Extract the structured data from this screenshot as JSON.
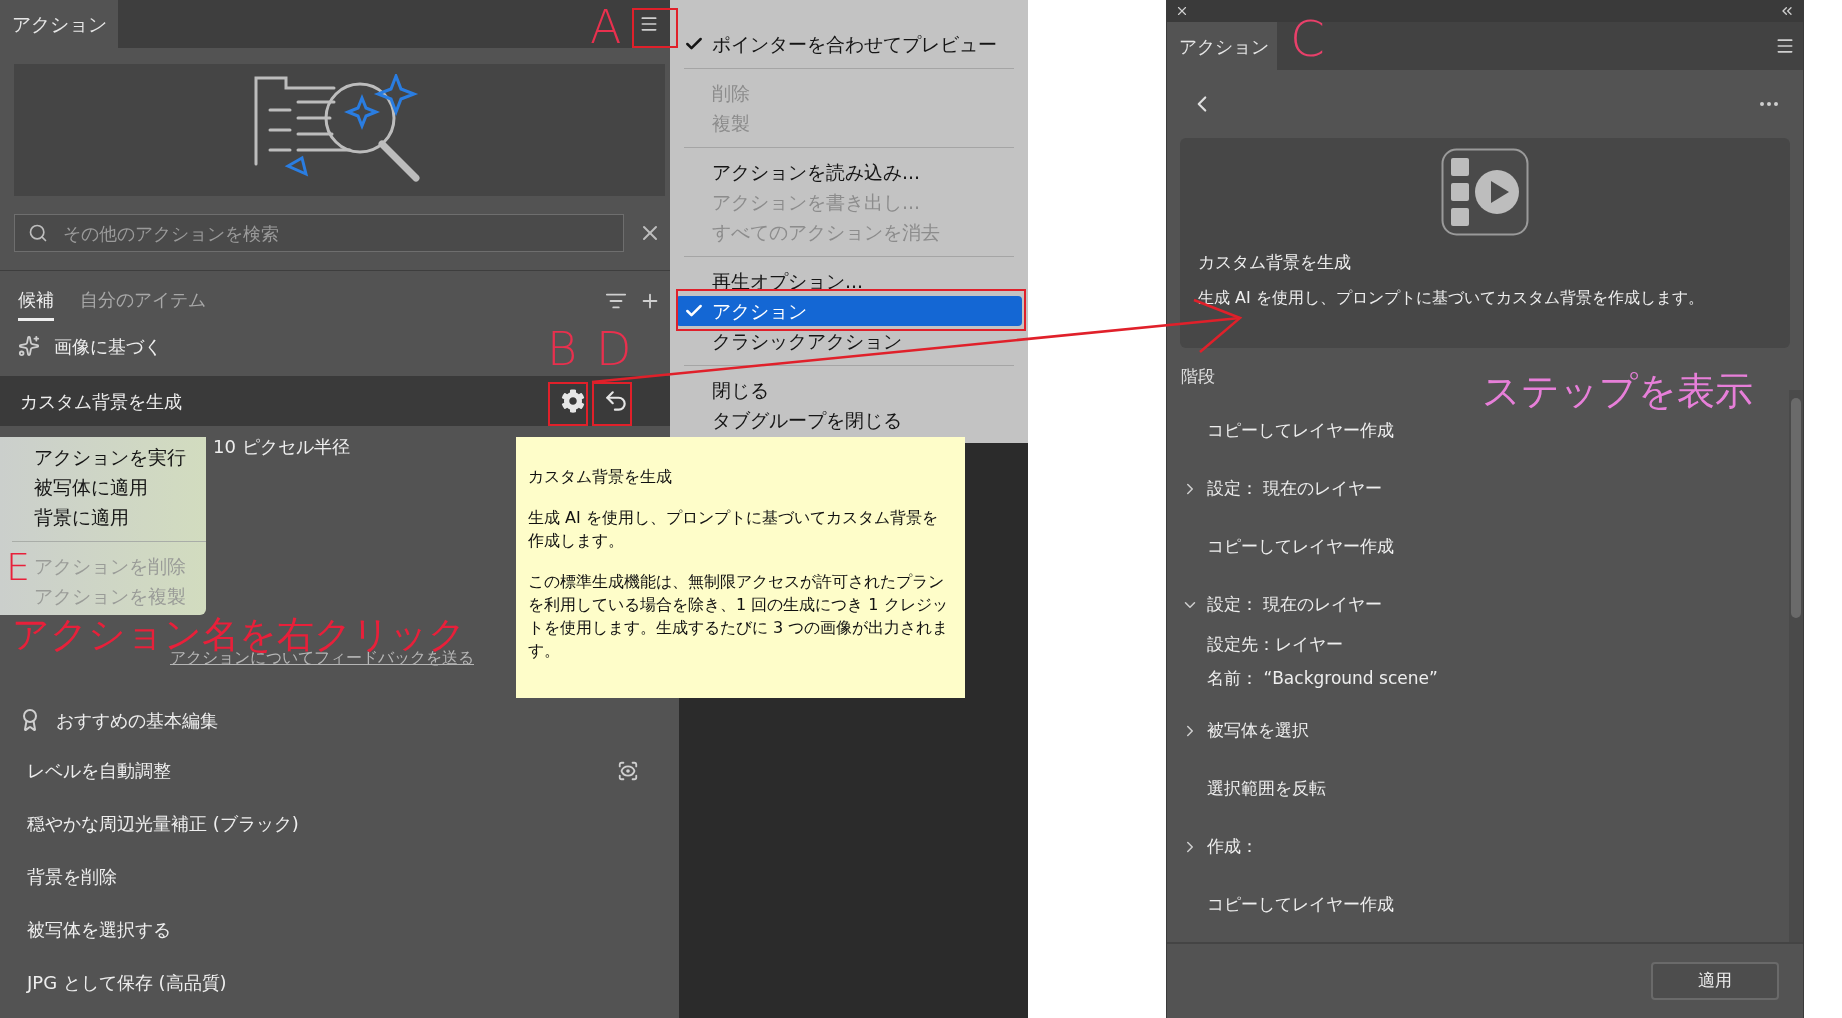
{
  "left_panel": {
    "tab": "アクション",
    "search": {
      "placeholder": "その他のアクションを検索"
    },
    "tabs": [
      {
        "label": "候補",
        "selected": true
      },
      {
        "label": "自分のアイテム",
        "selected": false
      }
    ],
    "section": "画像に基づく",
    "selected_action": "カスタム背景を生成",
    "partial_row": "10 ピクセル半径",
    "feedback_link": "アクションについてフィードバックを送る",
    "basic_section": "おすすめの基本編集",
    "basic_items": [
      {
        "label": "レベルを自動調整",
        "kind": "preview"
      },
      {
        "label": "穏やかな周辺光量補正 (ブラック)",
        "kind": "plain"
      },
      {
        "label": "背景を削除",
        "kind": "plain"
      },
      {
        "label": "被写体を選択する",
        "kind": "plain"
      },
      {
        "label": "JPG として保存 (高品質)",
        "kind": "plain"
      }
    ]
  },
  "panel_menu": {
    "groups": [
      [
        {
          "label": "ポインターを合わせてプレビュー",
          "checked": true,
          "disabled": false,
          "selected": false
        }
      ],
      [
        {
          "label": "削除",
          "checked": false,
          "disabled": true,
          "selected": false
        },
        {
          "label": "複製",
          "checked": false,
          "disabled": true,
          "selected": false
        }
      ],
      [
        {
          "label": "アクションを読み込み...",
          "checked": false,
          "disabled": false,
          "selected": false
        },
        {
          "label": "アクションを書き出し...",
          "checked": false,
          "disabled": true,
          "selected": false
        },
        {
          "label": "すべてのアクションを消去",
          "checked": false,
          "disabled": true,
          "selected": false
        }
      ],
      [
        {
          "label": "再生オプション...",
          "checked": false,
          "disabled": false,
          "selected": false
        },
        {
          "label": "アクション",
          "checked": true,
          "disabled": false,
          "selected": true
        },
        {
          "label": "クラシックアクション",
          "checked": false,
          "disabled": false,
          "selected": false
        }
      ],
      [
        {
          "label": "閉じる",
          "checked": false,
          "disabled": false,
          "selected": false
        },
        {
          "label": "タブグループを閉じる",
          "checked": false,
          "disabled": false,
          "selected": false
        }
      ]
    ]
  },
  "context_menu": {
    "groups": [
      [
        {
          "label": "アクションを実行",
          "disabled": false
        },
        {
          "label": "被写体に適用",
          "disabled": false
        },
        {
          "label": "背景に適用",
          "disabled": false
        }
      ],
      [
        {
          "label": "アクションを削除",
          "disabled": true
        },
        {
          "label": "アクションを複製",
          "disabled": true
        }
      ]
    ]
  },
  "tooltip": {
    "title": "カスタム背景を生成",
    "paragraphs": [
      "生成 AI を使用し、プロンプトに基づいてカスタム背景を作成します。",
      "この標準生成機能は、無制限アクセスが許可されたプランを利用している場合を除き、1 回の生成につき 1 クレジットを使用します。生成するたびに 3 つの画像が出力されます。"
    ]
  },
  "right_panel": {
    "tab": "アクション",
    "card": {
      "title": "カスタム背景を生成",
      "description": "生成 AI を使用し、プロンプトに基づいてカスタム背景を作成します。"
    },
    "steps_label": "階段",
    "steps": [
      {
        "label": "コピーしてレイヤー作成",
        "kind": "step"
      },
      {
        "label": "設定： 現在のレイヤー",
        "kind": "group",
        "expanded": false
      },
      {
        "label": "コピーしてレイヤー作成",
        "kind": "step"
      },
      {
        "label": "設定： 現在のレイヤー",
        "kind": "group",
        "expanded": true,
        "children": [
          {
            "label": "設定先：レイヤー"
          },
          {
            "label": "名前： “Background scene”"
          }
        ]
      },
      {
        "label": "被写体を選択",
        "kind": "group",
        "expanded": false
      },
      {
        "label": "選択範囲を反転",
        "kind": "step"
      },
      {
        "label": "作成：",
        "kind": "group",
        "expanded": false
      },
      {
        "label": "コピーしてレイヤー作成",
        "kind": "step"
      }
    ],
    "apply_button": "適用"
  },
  "annotations": [
    {
      "text": "A",
      "color": "#e8304e"
    },
    {
      "text": "B",
      "color": "#e8304e"
    },
    {
      "text": "D",
      "color": "#e8304e"
    },
    {
      "text": "E",
      "color": "#e8203a"
    },
    {
      "text": "アクション名を右クリック",
      "color": "#e8203a"
    },
    {
      "text": "C",
      "color": "#e8406a"
    },
    {
      "text": "ステップを表示",
      "color": "#e77fd9"
    }
  ]
}
